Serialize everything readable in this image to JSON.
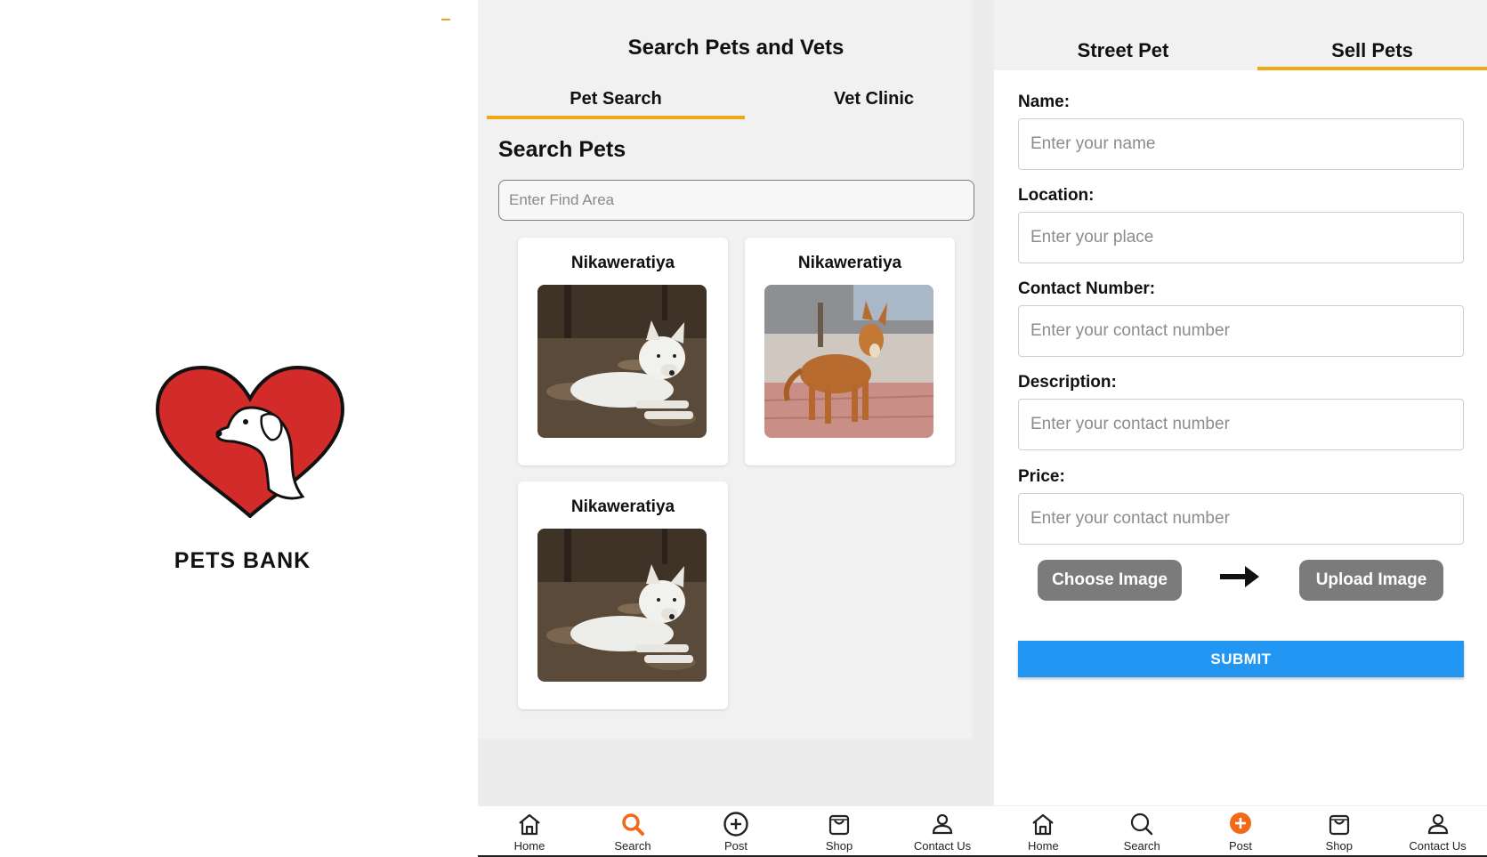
{
  "splash": {
    "brand": "PETS BANK"
  },
  "search_screen": {
    "title": "Search Pets and Vets",
    "tabs": [
      {
        "label": "Pet Search",
        "active": true
      },
      {
        "label": "Vet Clinic",
        "active": false
      }
    ],
    "section_heading": "Search Pets",
    "search_placeholder": "Enter Find Area",
    "pets": [
      {
        "location": "Nikaweratiya",
        "image": "white-dog-lying"
      },
      {
        "location": "Nikaweratiya",
        "image": "brown-dog-standing"
      },
      {
        "location": "Nikaweratiya",
        "image": "white-dog-lying"
      }
    ]
  },
  "sell_screen": {
    "tabs": [
      {
        "label": "Street Pet",
        "active": false
      },
      {
        "label": "Sell Pets",
        "active": true
      }
    ],
    "fields": [
      {
        "label": "Name:",
        "placeholder": "Enter your name"
      },
      {
        "label": "Location:",
        "placeholder": "Enter your place"
      },
      {
        "label": "Contact Number:",
        "placeholder": "Enter your contact number"
      },
      {
        "label": "Description:",
        "placeholder": "Enter your contact number"
      },
      {
        "label": "Price:",
        "placeholder": "Enter your contact number"
      }
    ],
    "choose_image_label": "Choose Image",
    "upload_image_label": "Upload Image",
    "submit_label": "SUBMIT"
  },
  "nav_left": [
    {
      "label": "Home",
      "icon": "home-icon",
      "active": false
    },
    {
      "label": "Search",
      "icon": "search-icon",
      "active": true
    },
    {
      "label": "Post",
      "icon": "plus-circle-icon",
      "active": false
    },
    {
      "label": "Shop",
      "icon": "shopping-bag-icon",
      "active": false
    },
    {
      "label": "Contact Us",
      "icon": "person-icon",
      "active": false
    }
  ],
  "nav_right": [
    {
      "label": "Home",
      "icon": "home-icon",
      "active": false
    },
    {
      "label": "Search",
      "icon": "search-icon",
      "active": false
    },
    {
      "label": "Post",
      "icon": "plus-circle-icon",
      "active": true
    },
    {
      "label": "Shop",
      "icon": "shopping-bag-icon",
      "active": false
    },
    {
      "label": "Contact Us",
      "icon": "person-icon",
      "active": false
    }
  ],
  "colors": {
    "accent": "#f0a71a",
    "active_nav": "#f06a1a",
    "submit_blue": "#2196f3",
    "heart_red": "#d32a2a",
    "pill_gray": "#7b7b7b"
  }
}
